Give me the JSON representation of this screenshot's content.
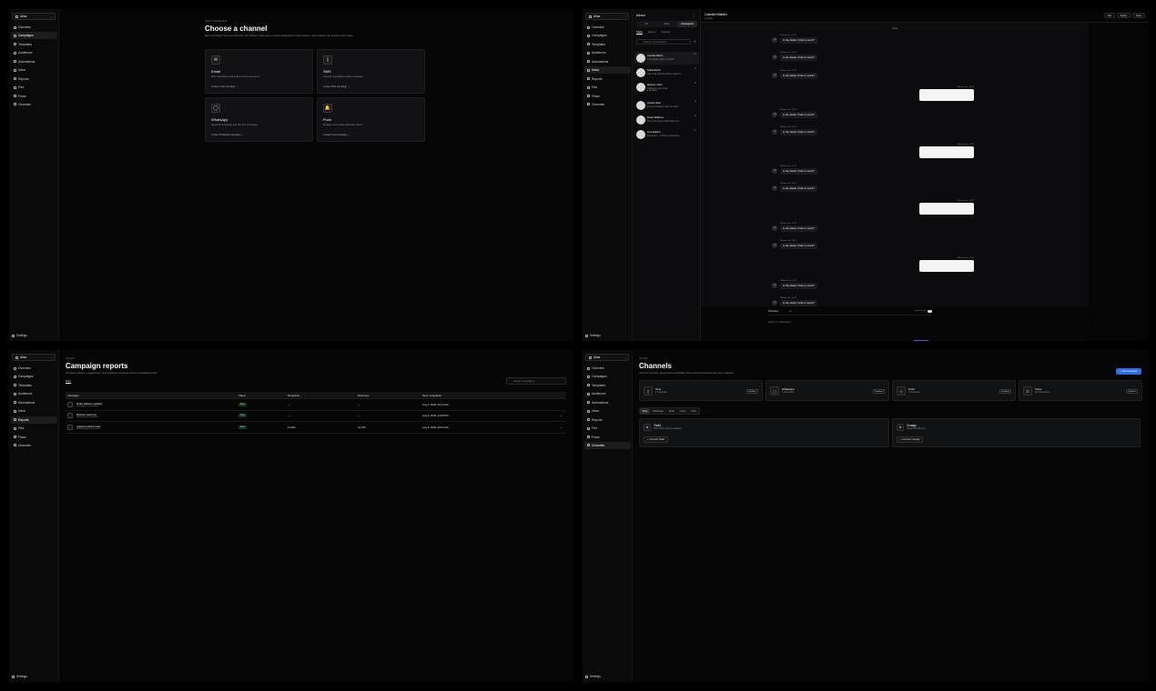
{
  "sidebar": {
    "workspace": "Atlas",
    "items": [
      "Overview",
      "Campaigns",
      "Templates",
      "Audiences",
      "Automations",
      "Inbox",
      "Reports",
      "Flex",
      "Flows",
      "Channels"
    ],
    "settings": "Settings"
  },
  "campaign": {
    "breadcrumb": "NEW CAMPAIGN",
    "title": "Choose a channel",
    "subtitle": "Each campaign uses one channel, with delivery rules and a content designed for that medium. Automations can combine them later.",
    "cards": [
      {
        "icon": "email-icon",
        "glyph": "✉",
        "title": "Email",
        "desc": "Rich newsletters and product announcements.",
        "link": "Create email campaign →"
      },
      {
        "icon": "sms-icon",
        "glyph": "▯",
        "title": "SMS",
        "desc": "Concise, immediate mobile messages.",
        "link": "Create SMS campaign →"
      },
      {
        "icon": "whatsapp-icon",
        "glyph": "◯",
        "title": "WhatsApp",
        "desc": "Approved templates and rich-text messages.",
        "link": "Create WhatsApp campaign →"
      },
      {
        "icon": "push-icon",
        "glyph": "🔔",
        "title": "Push",
        "desc": "Browser and mobile application alerts.",
        "link": "Create Push campaign →"
      }
    ]
  },
  "inbox": {
    "title": "Inbox",
    "segments": [
      "All",
      "Mine",
      "Unassigned"
    ],
    "active_segment": "Unassigned",
    "filters": [
      "Stage",
      "Agency",
      "Channel"
    ],
    "search_placeholder": "Search conversations",
    "conversations": [
      {
        "name": "Camila Martin",
        "preview": "Is the Atelier Chair in stock?",
        "time": "1m",
        "channel": ""
      },
      {
        "name": "Sofia Martin",
        "preview": "Can I pay with the delivery options…",
        "time": "1h",
        "channel": ""
      },
      {
        "name": "Marcus Chen",
        "preview": "Thanks for your help!",
        "time": "3h",
        "channel": "● Pending"
      },
      {
        "name": "Amara Osei",
        "preview": "Is there a different item for order…",
        "time": "1d",
        "channel": ""
      },
      {
        "name": "Noah Williams",
        "preview": "Can I get product dimensions for…",
        "time": "3d",
        "channel": ""
      },
      {
        "name": "Lina Hakimi",
        "preview": "Received! — Follow up tomorrow",
        "time": "1w",
        "channel": ""
      }
    ],
    "chat": {
      "name": "Camila Martin",
      "status": "● Online",
      "buttons": [
        "Call",
        "Assign",
        "Close"
      ],
      "day": "Today",
      "message": "Is the Atelier Chair in stock?",
      "incoming_meta": "Website chat · 09:21",
      "outgoing_meta": "Website chat · 09:22",
      "composer_channel": "WhatsApp",
      "composer_toggle": "Internal note",
      "composer_placeholder": "Reply on WhatsApp…"
    }
  },
  "reports": {
    "breadcrumb": "ATLAS",
    "title": "Campaign reports",
    "subtitle": "Compare delivery, engagement, and audience response across completed sends.",
    "tab": "Sent",
    "search_placeholder": "Search campaigns...",
    "columns": [
      "Campaign",
      "Status",
      "Recipients",
      "Delivered",
      "Sent / scheduled"
    ],
    "rows": [
      {
        "name": "Order delivery updates",
        "sub": "WhatsApp · transactional",
        "status": "Sent",
        "recipients": "—",
        "delivered": "—",
        "sent": "Aug 4, 2026, 09:14 AM",
        "more": ""
      },
      {
        "name": "Member welcome",
        "sub": "Welcome new members",
        "status": "Sent",
        "recipients": "—",
        "delivered": "—",
        "sent": "Aug 6, 2026, 12:08 PM",
        "more": "⋯"
      },
      {
        "name": "August product notes",
        "sub": "Monthly update to all users",
        "status": "Sent",
        "recipients": "14,862",
        "delivered": "14,705",
        "sent": "Aug 8, 2026, 09:04 AM",
        "more": "⋯"
      }
    ]
  },
  "channels": {
    "breadcrumb": "ATLAS",
    "title": "Channels",
    "subtitle": "Connect senders, synchronize templates, and monitor the access for every channel.",
    "add_button": "+ Add connection",
    "cards": [
      {
        "icon": "sms-icon",
        "glyph": "▯",
        "name": "Sms",
        "sub": "1 connection",
        "state": "Enabled"
      },
      {
        "icon": "whatsapp-icon",
        "glyph": "◯",
        "name": "Whatsapp",
        "sub": "1 connection",
        "state": "Enabled"
      },
      {
        "icon": "push-icon",
        "glyph": "◇",
        "name": "Push",
        "sub": "1 connection",
        "state": "Enabled"
      },
      {
        "icon": "voice-icon",
        "glyph": "✆",
        "name": "Voice",
        "sub": "No connections",
        "state": "Enabled"
      }
    ],
    "filter_tabs": [
      "Sms",
      "Whatsapp",
      "Push",
      "Voice",
      "Chat"
    ],
    "active_filter": "Sms",
    "providers": [
      {
        "icon": "twilio-icon",
        "glyph": "⇆",
        "name": "Twilio",
        "desc": "SMS, MMS, delivery callbacks",
        "button": "+ Connect Twilio"
      },
      {
        "icon": "vonage-icon",
        "glyph": "⇆",
        "name": "Vonage",
        "desc": "Global SMS delivery",
        "button": "+ Connect Vonage"
      }
    ]
  }
}
